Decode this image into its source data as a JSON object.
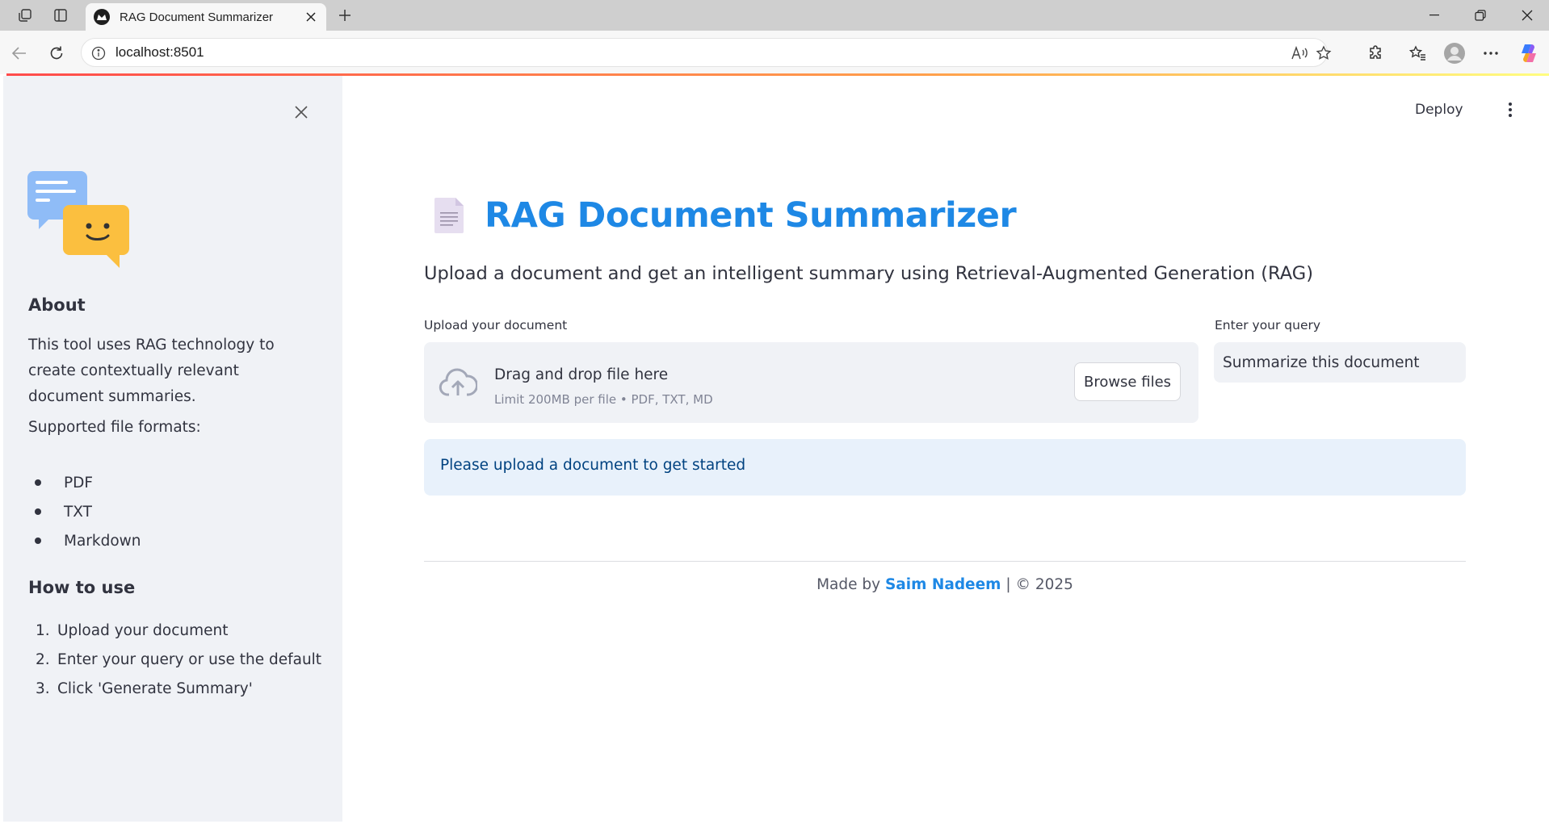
{
  "browser": {
    "tab_title": "RAG Document Summarizer",
    "url": "localhost:8501"
  },
  "sidebar": {
    "about_heading": "About",
    "about_text": "This tool uses RAG technology to create contextually relevant document summaries.",
    "formats_label": "Supported file formats:",
    "formats": [
      "PDF",
      "TXT",
      "Markdown"
    ],
    "howto_heading": "How to use",
    "steps": [
      {
        "num": "1.",
        "text": "Upload your document"
      },
      {
        "num": "2.",
        "text": "Enter your query or use the default"
      },
      {
        "num": "3.",
        "text": "Click 'Generate Summary'"
      }
    ]
  },
  "header": {
    "deploy_label": "Deploy"
  },
  "main": {
    "title": "RAG Document Summarizer",
    "subtitle": "Upload a document and get an intelligent summary using Retrieval-Augmented Generation (RAG)",
    "upload_label": "Upload your document",
    "dropzone_text": "Drag and drop file here",
    "dropzone_limit": "Limit 200MB per file • PDF, TXT, MD",
    "browse_label": "Browse files",
    "query_label": "Enter your query",
    "query_value": "Summarize this document",
    "info_message": "Please upload a document to get started"
  },
  "footer": {
    "prefix": "Made by",
    "author": "Saim Nadeem",
    "suffix": "| © 2025"
  },
  "colors": {
    "accent": "#1e88e5",
    "sidebar_bg": "#f0f2f6",
    "info_bg": "#e8f1fb",
    "info_text": "#004280"
  }
}
